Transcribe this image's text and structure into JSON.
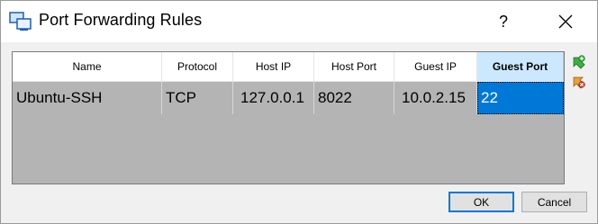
{
  "window": {
    "title": "Port Forwarding Rules",
    "help_label": "?"
  },
  "table": {
    "columns": [
      "Name",
      "Protocol",
      "Host IP",
      "Host Port",
      "Guest IP",
      "Guest Port"
    ],
    "active_column": "Guest Port",
    "rows": [
      {
        "name": "Ubuntu-SSH",
        "protocol": "TCP",
        "host_ip": "127.0.0.1",
        "host_port": "8022",
        "guest_ip": "10.0.2.15",
        "guest_port": "22"
      }
    ]
  },
  "side_tools": [
    "add-rule-icon",
    "remove-rule-icon"
  ],
  "buttons": {
    "ok": "OK",
    "cancel": "Cancel"
  },
  "colors": {
    "selection": "#0078d7",
    "active_header": "#cce8ff",
    "table_background": "#b4b4b4"
  }
}
